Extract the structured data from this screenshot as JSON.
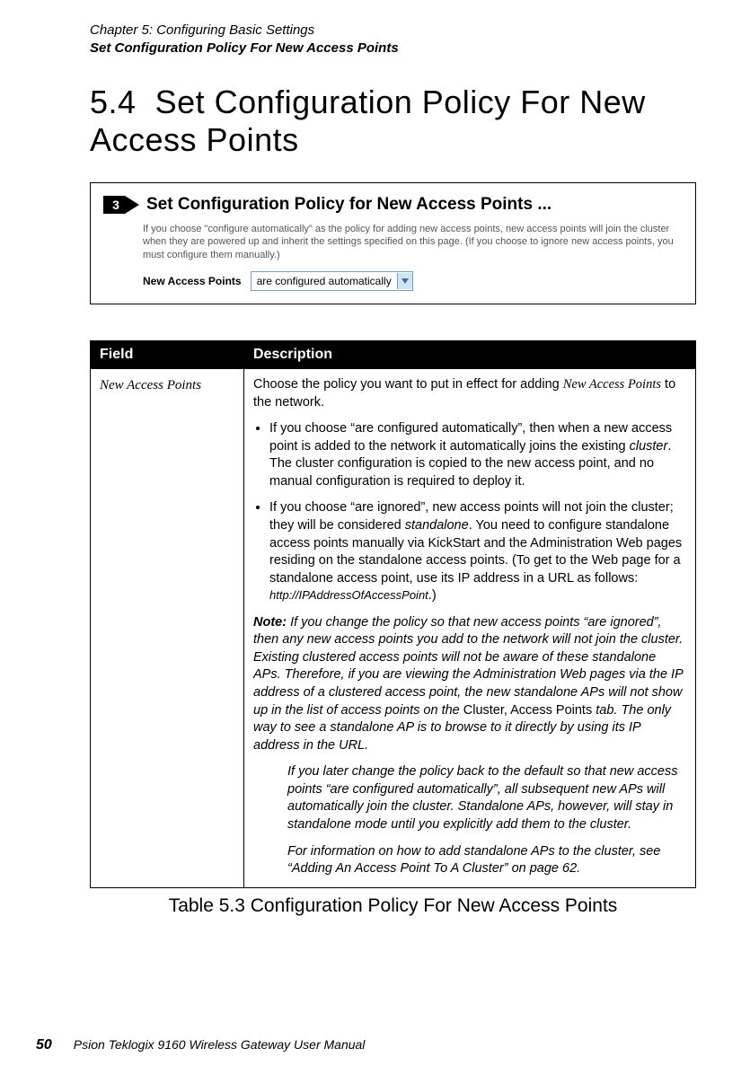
{
  "running_head": {
    "line1": "Chapter 5:  Configuring Basic Settings",
    "line2": "Set Configuration Policy For New Access Points"
  },
  "section": {
    "number": "5.4",
    "title": "Set Configuration Policy For New Access Points"
  },
  "screenshot": {
    "marker_number": "3",
    "title": "Set Configuration Policy for New Access Points ...",
    "description": "If you choose \"configure automatically\" as the policy for adding new access points, new access points will join the cluster when they are powered up and inherit the settings specified on this page. (If you choose to ignore new access points, you must configure them manually.)",
    "field_label": "New Access Points",
    "select_value": "are configured automatically"
  },
  "table": {
    "header_field": "Field",
    "header_desc": "Description",
    "row": {
      "field": "New Access Points",
      "intro_a": "Choose the policy you want to put in effect for adding ",
      "intro_term": "New Access Points",
      "intro_b": " to the network.",
      "bullet1_a": "If you choose “are configured automatically”, then when a new access point is added to the network it automatically joins the existing ",
      "bullet1_term": "cluster",
      "bullet1_b": ". The cluster configuration is copied to the new access point, and no manual configuration is required to deploy it.",
      "bullet2_a": "If you choose “are ignored”, new access points will not join the cluster; they will be considered ",
      "bullet2_term": "standalone",
      "bullet2_b": ". You need to configure standalone access points manually via KickStart and the Administration Web pages residing on the standalone access points. (To get to the Web page for a standalone access point, use its IP address in a URL as follows: ",
      "bullet2_url": "http://IPAddressOfAccessPoint",
      "bullet2_c": ".)",
      "note_label": "Note:",
      "note_p1_a": " If you change the policy so that new access points “are ignored”, then any new access points you add to the network will not join the cluster. Existing clustered access points will not be aware of these standalone APs. Therefore, if you are viewing the Administration Web pages via the IP address of a clustered access point, the new standalone APs will not show up in the list of access points on the ",
      "note_p1_tab": "Cluster, Access Points",
      "note_p1_b": " tab. The only way to see a standalone AP is to browse to it directly by using its IP address in the URL.",
      "note_p2": "If you later change the policy back to the default so that new access points “are configured automatically”, all subsequent new APs will automatically join the cluster. Standalone APs, however, will stay in standalone mode until you explicitly add them to the cluster.",
      "note_p3": "For information on how to add standalone APs to the cluster, see “Adding An Access Point To A Cluster” on page 62."
    }
  },
  "table_caption": "Table 5.3 Configuration Policy For New Access Points",
  "footer": {
    "page_number": "50",
    "manual_title": "Psion Teklogix 9160 Wireless Gateway User Manual"
  }
}
